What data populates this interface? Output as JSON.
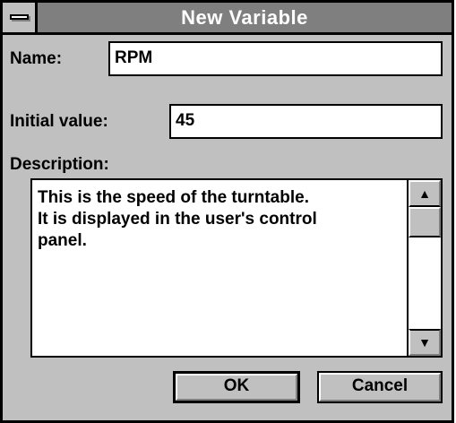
{
  "window": {
    "title": "New Variable"
  },
  "name_field": {
    "label": "Name:",
    "value": "RPM"
  },
  "initial_value_field": {
    "label": "Initial value:",
    "value": "45"
  },
  "description": {
    "label": "Description:",
    "text": "This is the speed of the turntable.\nIt is displayed in the user's control\npanel."
  },
  "scrollbar": {
    "up_icon": "▲",
    "down_icon": "▼"
  },
  "buttons": {
    "ok_label": "OK",
    "cancel_label": "Cancel"
  },
  "colors": {
    "title_bar": "#7f7f7f",
    "dialog_face": "#c0c0c0",
    "border": "#000000",
    "field_background": "#ffffff"
  }
}
